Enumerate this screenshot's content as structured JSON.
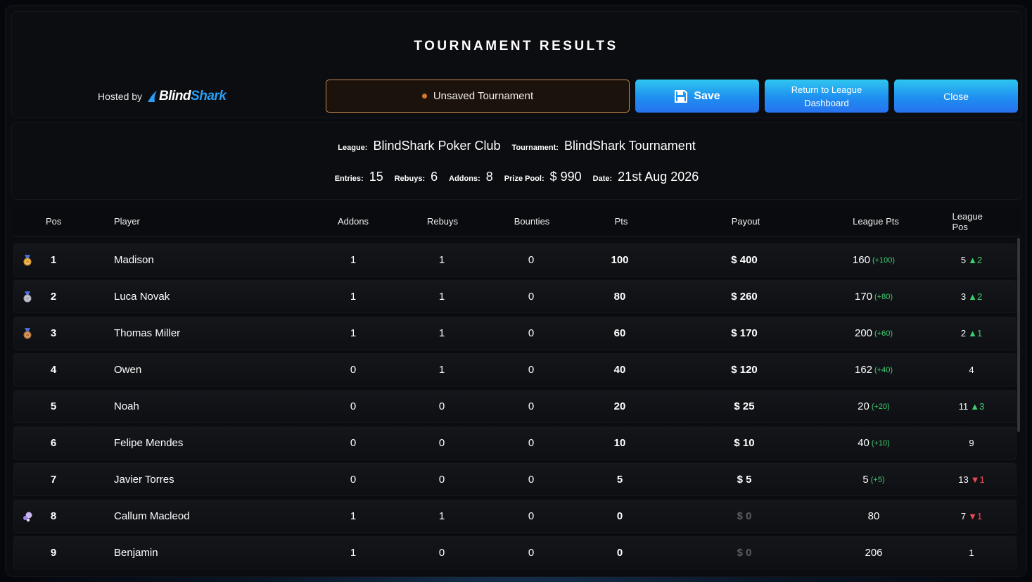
{
  "header": {
    "title": "TOURNAMENT RESULTS",
    "hosted_by_label": "Hosted by",
    "brand_part1": "Blind",
    "brand_part2": "Shark",
    "status": "Unsaved Tournament",
    "save_label": "Save",
    "return_label": "Return to League Dashboard",
    "close_label": "Close"
  },
  "info": {
    "league_label": "League:",
    "league": "BlindShark Poker Club",
    "tournament_label": "Tournament:",
    "tournament": "BlindShark Tournament",
    "entries_label": "Entries:",
    "entries": "15",
    "rebuys_label": "Rebuys:",
    "rebuys": "6",
    "addons_label": "Addons:",
    "addons": "8",
    "prize_pool_label": "Prize Pool:",
    "prize_pool": "$ 990",
    "date_label": "Date:",
    "date": "21st Aug 2026"
  },
  "table": {
    "columns": {
      "pos": "Pos",
      "player": "Player",
      "addons": "Addons",
      "rebuys": "Rebuys",
      "bounties": "Bounties",
      "pts": "Pts",
      "payout": "Payout",
      "league_pts": "League Pts",
      "league_pos": "League Pos"
    },
    "rows": [
      {
        "badge": "gold-medal-icon",
        "pos": "1",
        "player": "Madison",
        "addons": "1",
        "rebuys": "1",
        "bounties": "0",
        "pts": "100",
        "payout": "$ 400",
        "league_pts": "160",
        "league_pts_delta": "(+100)",
        "league_pos": "5",
        "trend": "up",
        "trend_value": "2"
      },
      {
        "badge": "silver-medal-icon",
        "pos": "2",
        "player": "Luca Novak",
        "addons": "1",
        "rebuys": "1",
        "bounties": "0",
        "pts": "80",
        "payout": "$ 260",
        "league_pts": "170",
        "league_pts_delta": "(+80)",
        "league_pos": "3",
        "trend": "up",
        "trend_value": "2"
      },
      {
        "badge": "bronze-medal-icon",
        "pos": "3",
        "player": "Thomas Miller",
        "addons": "1",
        "rebuys": "1",
        "bounties": "0",
        "pts": "60",
        "payout": "$ 170",
        "league_pts": "200",
        "league_pts_delta": "(+60)",
        "league_pos": "2",
        "trend": "up",
        "trend_value": "1"
      },
      {
        "badge": "",
        "pos": "4",
        "player": "Owen",
        "addons": "0",
        "rebuys": "1",
        "bounties": "0",
        "pts": "40",
        "payout": "$ 120",
        "league_pts": "162",
        "league_pts_delta": "(+40)",
        "league_pos": "4",
        "trend": "",
        "trend_value": ""
      },
      {
        "badge": "",
        "pos": "5",
        "player": "Noah",
        "addons": "0",
        "rebuys": "0",
        "bounties": "0",
        "pts": "20",
        "payout": "$ 25",
        "league_pts": "20",
        "league_pts_delta": "(+20)",
        "league_pos": "11",
        "trend": "up",
        "trend_value": "3"
      },
      {
        "badge": "",
        "pos": "6",
        "player": "Felipe Mendes",
        "addons": "0",
        "rebuys": "0",
        "bounties": "0",
        "pts": "10",
        "payout": "$ 10",
        "league_pts": "40",
        "league_pts_delta": "(+10)",
        "league_pos": "9",
        "trend": "",
        "trend_value": ""
      },
      {
        "badge": "",
        "pos": "7",
        "player": "Javier Torres",
        "addons": "0",
        "rebuys": "0",
        "bounties": "0",
        "pts": "5",
        "payout": "$ 5",
        "league_pts": "5",
        "league_pts_delta": "(+5)",
        "league_pos": "13",
        "trend": "down",
        "trend_value": "1"
      },
      {
        "badge": "bubble-icon",
        "pos": "8",
        "player": "Callum Macleod",
        "addons": "1",
        "rebuys": "1",
        "bounties": "0",
        "pts": "0",
        "payout": "$ 0",
        "league_pts": "80",
        "league_pts_delta": "",
        "league_pos": "7",
        "trend": "down",
        "trend_value": "1"
      },
      {
        "badge": "",
        "pos": "9",
        "player": "Benjamin",
        "addons": "1",
        "rebuys": "0",
        "bounties": "0",
        "pts": "0",
        "payout": "$ 0",
        "league_pts": "206",
        "league_pts_delta": "",
        "league_pos": "1",
        "trend": "",
        "trend_value": ""
      }
    ]
  },
  "colors": {
    "accent_blue": "#1f8ff0",
    "unsaved_border": "#c98a4c",
    "positive": "#3ecf6e",
    "negative": "#ef4a52"
  }
}
